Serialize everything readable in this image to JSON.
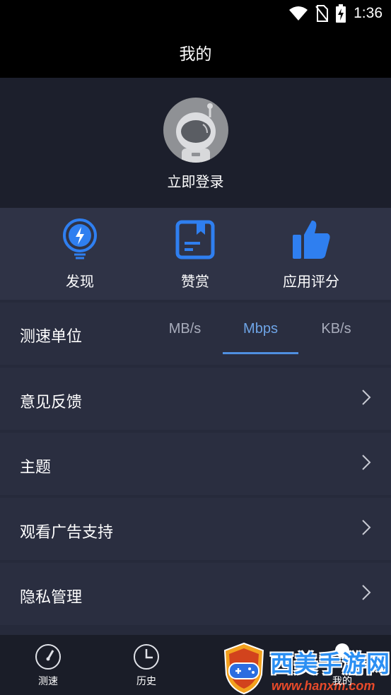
{
  "status_bar": {
    "time": "1:36"
  },
  "header": {
    "title": "我的"
  },
  "profile": {
    "login_label": "立即登录"
  },
  "quick_actions": [
    {
      "label": "发现",
      "icon": "lightning-bulb-icon"
    },
    {
      "label": "赞赏",
      "icon": "bookmark-book-icon"
    },
    {
      "label": "应用评分",
      "icon": "thumbs-up-icon"
    }
  ],
  "speed_unit": {
    "label": "测速单位",
    "options": [
      "MB/s",
      "Mbps",
      "KB/s"
    ],
    "selected": "Mbps"
  },
  "menu": [
    {
      "label": "意见反馈"
    },
    {
      "label": "主题"
    },
    {
      "label": "观看广告支持"
    },
    {
      "label": "隐私管理"
    }
  ],
  "bottom_nav": [
    {
      "label": "测速",
      "icon": "speedometer-icon"
    },
    {
      "label": "历史",
      "icon": "clock-icon"
    },
    {
      "label": "我的",
      "icon": "person-icon",
      "active": true
    }
  ],
  "watermark": {
    "text": "西美手游网",
    "url": "www.hanxm.com"
  },
  "colors": {
    "accent": "#2f7ff0",
    "background": "#262a3b",
    "tab_active": "#6ea4e6"
  }
}
